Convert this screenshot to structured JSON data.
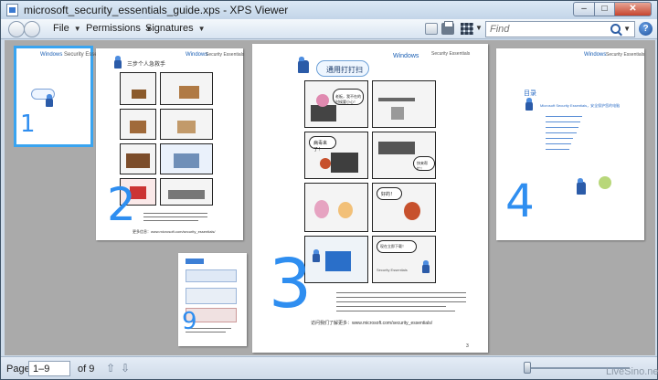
{
  "window": {
    "title": "microsoft_security_essentials_guide.xps - XPS Viewer",
    "minimize_glyph": "–",
    "maximize_glyph": "□",
    "close_glyph": "✕"
  },
  "toolbar": {
    "menus": [
      {
        "label": "File"
      },
      {
        "label": "Permissions"
      },
      {
        "label": "Signatures"
      }
    ],
    "find": {
      "placeholder": "Find"
    },
    "help_glyph": "?"
  },
  "thumbnails": {
    "page1": {
      "number": "1",
      "logo_text": "Windows",
      "logo_product": "Security Essentials"
    },
    "page2": {
      "number": "2",
      "logo_text": "Windows",
      "logo_product": "Security Essentials",
      "comic_title": "三步个人急救手",
      "footer_text": "更多信息：www.microsoft.com/security_essentials/"
    },
    "page9": {
      "number": "9"
    },
    "page3": {
      "number": "3",
      "logo_text": "Windows",
      "logo_product": "Security Essentials",
      "comic_title": "通用打打扫",
      "bubble_1": "现在立即下载！",
      "bubble_2": "老板，我不在的时候要小心！",
      "bubble_3": "好的！",
      "bubble_4": "病毒来了！",
      "bubble_5": "快来帮忙！",
      "panel_badge": "Security Essentials",
      "footer_text": "访问我们了解更多：www.microsoft.com/security_essentials/",
      "page_no": "3"
    },
    "page4": {
      "number": "4",
      "logo_text": "Windows",
      "logo_product": "Security Essentials",
      "toc_title": "目录",
      "toc_heading": "Microsoft Security Essentials，安全保护您的电脑"
    }
  },
  "statusbar": {
    "page_label": "Page",
    "page_value": "1–9",
    "of_label": "of 9",
    "watermark": "LiveSino.net"
  }
}
